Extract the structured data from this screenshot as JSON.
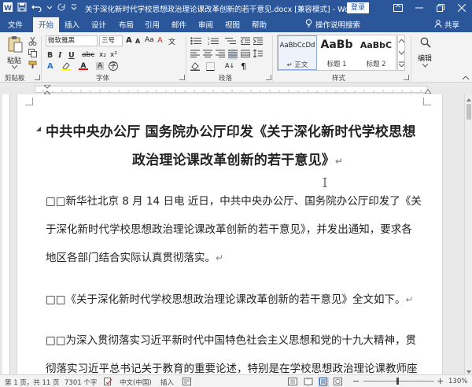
{
  "titlebar": {
    "title": "关于深化新时代学校思想政治理论课改革创新的若干意见.docx [兼容模式] - Word",
    "login_label": "登录"
  },
  "tabs": [
    "文件",
    "开始",
    "插入",
    "设计",
    "布局",
    "引用",
    "邮件",
    "审阅",
    "视图",
    "帮助"
  ],
  "active_tab": "开始",
  "tell_me": "操作说明搜索",
  "share": "共享",
  "ribbon": {
    "paste_label": "粘贴",
    "font_name": "微软雅黑",
    "font_size": "三号",
    "bold": "B",
    "italic": "I",
    "underline": "U",
    "styles": [
      {
        "preview": "AaBbCcDd",
        "name": "正文"
      },
      {
        "preview": "AaBb",
        "name": "标题 1"
      },
      {
        "preview": "AaBbC",
        "name": "标题 2"
      }
    ],
    "edit_label": "编辑",
    "groups": {
      "clipboard": "剪贴板",
      "font": "字体",
      "paragraph": "段落",
      "styles": "样式"
    }
  },
  "document": {
    "heading_line1": "中共中央办公厅 国务院办公厅印发《关于深化新时代学校思想",
    "heading_line2": "政治理论课改革创新的若干意见》",
    "para1_line1": "□□新华社北京 8 月 14 日电 近日，中共中央办公厅、国务院办公厅印发了《关",
    "para1_line2": "于深化新时代学校思想政治理论课改革创新的若干意见》，并发出通知，要求各",
    "para1_line3": "地区各部门结合实际认真贯彻落实。",
    "para2_line1": "□□《关于深化新时代学校思想政治理论课改革创新的若干意见》全文如下。",
    "para3_line1": "□□为深入贯彻落实习近平新时代中国特色社会主义思想和党的十九大精神，贯",
    "para3_line2": "彻落实习近平总书记关于教育的重要论述，特别是在学校思想政治理论课教师座",
    "paragraph_mark": "↵"
  },
  "statusbar": {
    "page": "第 1 页，共 11 页",
    "words": "7301 个字",
    "language": "中文(中国)",
    "insert_mode": "插入",
    "zoom": "130%"
  },
  "colors": {
    "brand": "#2b579a"
  }
}
